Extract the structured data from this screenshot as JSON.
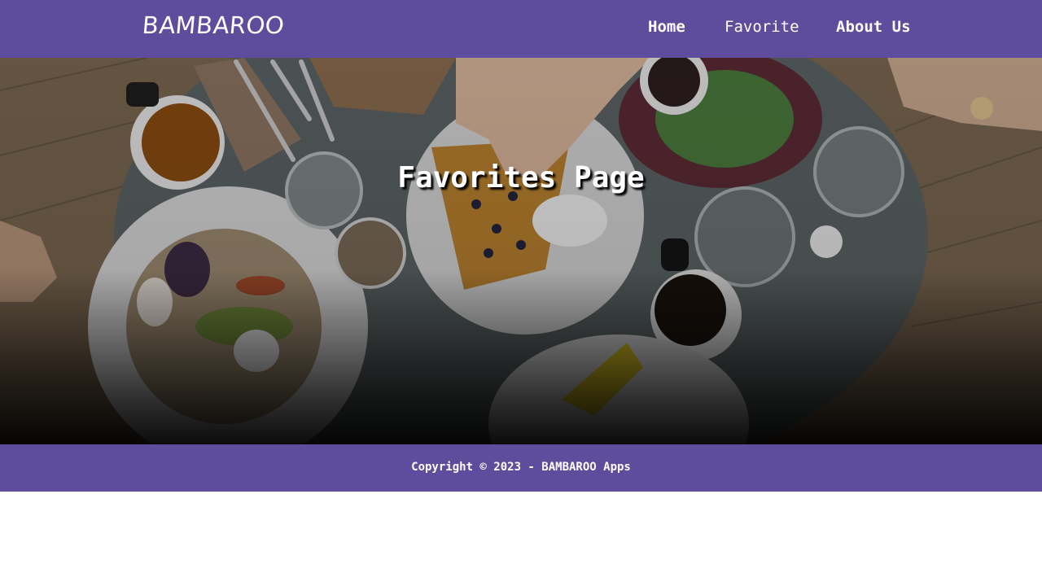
{
  "header": {
    "brand": "BAMBAROO",
    "nav": [
      {
        "label": "Home"
      },
      {
        "label": "Favorite"
      },
      {
        "label": "About Us"
      }
    ]
  },
  "hero": {
    "title": "Favorites Page",
    "background_image": "brunch-table-photo"
  },
  "footer": {
    "copyright": "Copyright © 2023 - BAMBAROO Apps"
  },
  "colors": {
    "brand_purple": "#5e4c9d",
    "text": "#ffffff"
  }
}
